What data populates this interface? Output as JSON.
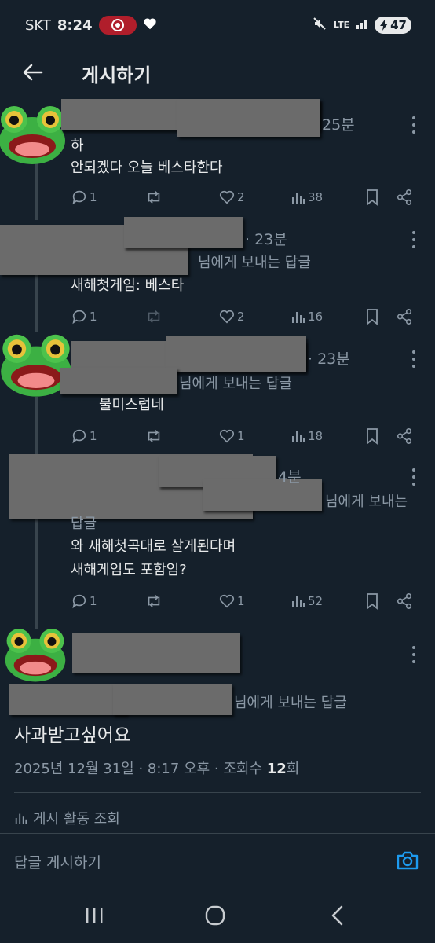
{
  "status_bar": {
    "carrier": "SKT",
    "time": "8:24",
    "network": "LTE",
    "battery": "47"
  },
  "header": {
    "title": "게시하기"
  },
  "replies": [
    {
      "time": "25분",
      "lines": [
        "하",
        "안되겠다 오늘 베스타한다"
      ],
      "reply_count": "1",
      "retweet_count": "",
      "like_count": "2",
      "view_count": "38"
    },
    {
      "time": "· 23분",
      "replying_to": "님에게 보내는 답글",
      "lines": [
        "새해첫게임: 베스타"
      ],
      "reply_count": "1",
      "retweet_count": "",
      "like_count": "2",
      "view_count": "16"
    },
    {
      "time": "· 23분",
      "replying_to": "님에게 보내는 답글",
      "lines": [
        "불미스럽네"
      ],
      "reply_count": "1",
      "retweet_count": "",
      "like_count": "1",
      "view_count": "18"
    },
    {
      "time": "4분",
      "replying_to": "님에게 보내는",
      "replying_to_cont": "답글",
      "lines": [
        "와 새해첫곡대로 살게된다며",
        "새해게임도 포함임?"
      ],
      "reply_count": "1",
      "retweet_count": "",
      "like_count": "1",
      "view_count": "52"
    }
  ],
  "main_post": {
    "replying_to": "님에게 보내는 답글",
    "text": "사과받고싶어요",
    "timestamp": "2025년 12월 31일 · 8:17 오후 · 조회수 ",
    "views": "12",
    "views_suffix": "회",
    "activity_label": "게시 활동 조회"
  },
  "reply_bar": {
    "placeholder": "답글 게시하기"
  },
  "colors": {
    "background": "#15202b",
    "text": "#e7e9ea",
    "muted": "#8b98a5",
    "accent": "#1d9bf0",
    "redaction": "#6b6b6b"
  }
}
